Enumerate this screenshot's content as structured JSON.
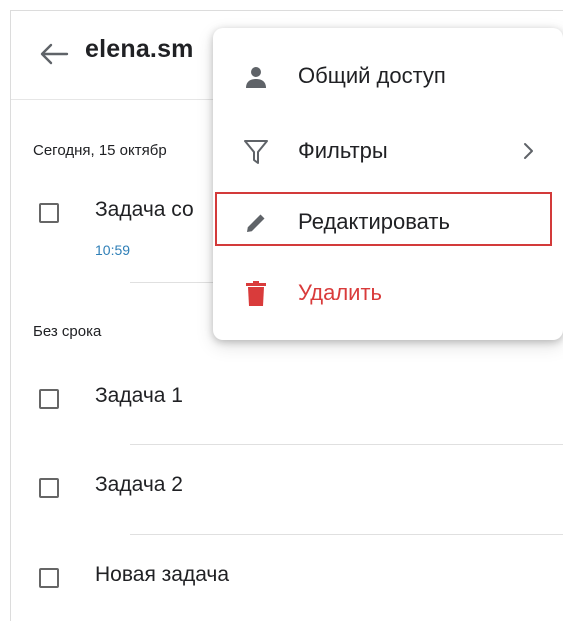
{
  "header": {
    "title": "elena.sm"
  },
  "sections": [
    {
      "label": "Сегодня, 15 октябр",
      "tasks": [
        {
          "text": "Задача со",
          "time": "10:59"
        }
      ]
    },
    {
      "label": "Без срока",
      "tasks": [
        {
          "text": "Задача 1"
        },
        {
          "text": "Задача 2"
        },
        {
          "text": "Новая задача"
        }
      ]
    }
  ],
  "menu": {
    "items": [
      {
        "label": "Общий доступ",
        "icon": "person-icon"
      },
      {
        "label": "Фильтры",
        "icon": "filter-icon",
        "submenu": true
      },
      {
        "label": "Редактировать",
        "icon": "pencil-icon",
        "highlighted": true
      },
      {
        "label": "Удалить",
        "icon": "trash-icon",
        "danger": true
      }
    ]
  },
  "colors": {
    "danger": "#d93b3b",
    "time": "#2f7fb7",
    "highlight_border": "#d33a3a"
  }
}
